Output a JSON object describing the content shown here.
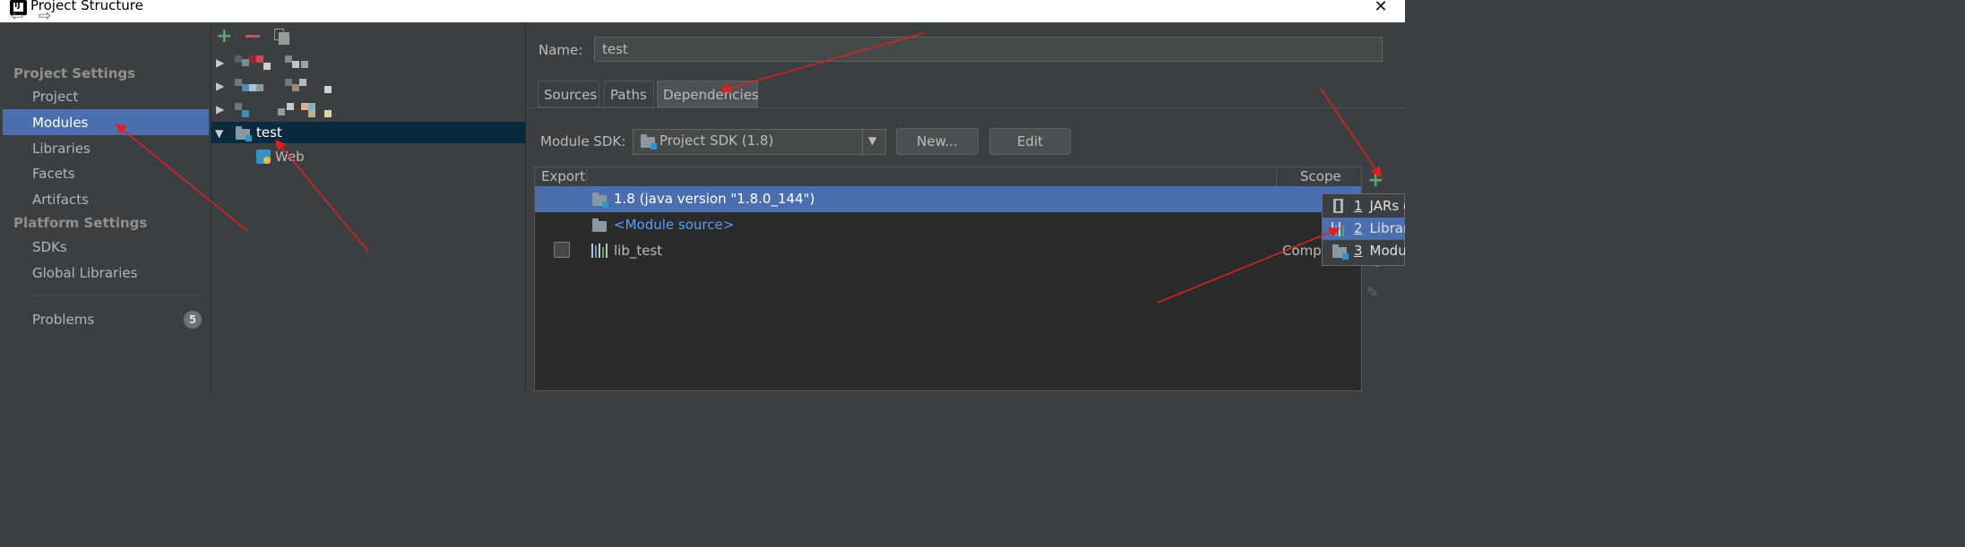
{
  "window": {
    "title": "Project Structure"
  },
  "nav": {
    "project_settings_header": "Project Settings",
    "items_project": [
      "Project",
      "Modules",
      "Libraries",
      "Facets",
      "Artifacts"
    ],
    "platform_settings_header": "Platform Settings",
    "items_platform": [
      "SDKs",
      "Global Libraries"
    ],
    "problems_label": "Problems",
    "problems_count": "5",
    "selected": "Modules"
  },
  "tree": {
    "toolbar": [
      "add-icon",
      "remove-icon",
      "copy-icon"
    ],
    "selected_module": "test",
    "child_facet": "Web"
  },
  "module": {
    "name_label": "Name:",
    "name_value": "test",
    "tabs": [
      "Sources",
      "Paths",
      "Dependencies"
    ],
    "active_tab": "Dependencies",
    "sdk_label": "Module SDK:",
    "sdk_value": "Project SDK (1.8)",
    "new_button": "New...",
    "edit_button": "Edit"
  },
  "dependencies": {
    "columns": [
      "Export",
      "Scope"
    ],
    "rows": [
      {
        "name": "1.8 (java version \"1.8.0_144\")",
        "scope": ""
      },
      {
        "name": "<Module source>",
        "scope": ""
      },
      {
        "name": "lib_test",
        "scope": "Comp"
      }
    ]
  },
  "add_menu": {
    "items": [
      {
        "num": "1",
        "label": "JARs or"
      },
      {
        "num": "2",
        "label": "Library"
      },
      {
        "num": "3",
        "label": "Module"
      }
    ]
  },
  "colors": {
    "selection": "#4b6eaf",
    "tree_selection": "#0d293e",
    "annotation_arrow": "#e0201f",
    "add_green": "#59a869",
    "remove_red": "#c75450"
  }
}
